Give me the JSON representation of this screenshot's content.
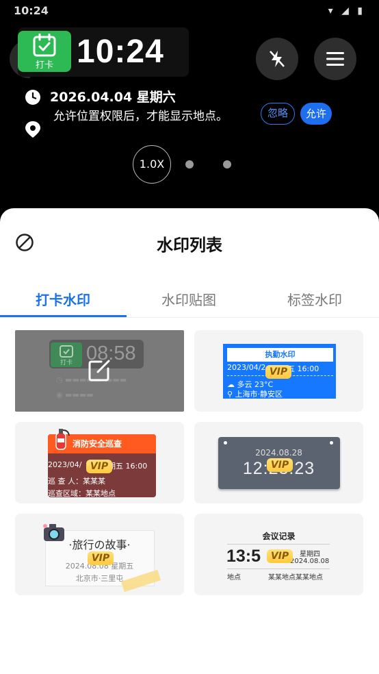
{
  "status_bar": {
    "time": "10:24",
    "icons": "▾ ◢ ▮"
  },
  "watermark_preview": {
    "badge_label": "打卡",
    "clock": "10:24",
    "date": "2026.04.04 星期六",
    "permission_text": "允许位置权限后，才能显示地点。",
    "ignore_label": "忽略",
    "allow_label": "允许"
  },
  "camera": {
    "zoom_label": "1.0X"
  },
  "sheet": {
    "title": "水印列表",
    "tabs": [
      {
        "label": "打卡水印",
        "active": true
      },
      {
        "label": "水印贴图",
        "active": false
      },
      {
        "label": "标签水印",
        "active": false
      }
    ]
  },
  "vip_label": "VIP",
  "templates": {
    "punch": {
      "badge": "打卡",
      "clock": "08:58"
    },
    "attendance": {
      "header": "执勤水印",
      "datetime": "2023/04/2",
      "day_time": "五 16:00",
      "weather": "多云 23°C",
      "location": "上海市·静安区"
    },
    "fire": {
      "header": "消防安全巡查",
      "datetime": "2023/04/",
      "day_time": "期五 16:00",
      "inspector": "巡 查 人：某某某",
      "area": "巡查区域：某某地点"
    },
    "plate": {
      "date": "2024.08.28",
      "time": "12:23:23"
    },
    "travel": {
      "title": "·旅行の故事·",
      "date": "2024.0",
      "date2": "8.08",
      "weekday": "星期五",
      "place": "北京市·三里屯"
    },
    "meeting": {
      "title": "会议记录",
      "time": "13:5",
      "weekday": "星期四",
      "date": "2024.08.08",
      "location_label": "地点",
      "location_value": "某某地点某某地点"
    }
  },
  "colors": {
    "accent": "#1a73e8",
    "badge_green": "#2dba55",
    "vip": "#ffc93c"
  }
}
